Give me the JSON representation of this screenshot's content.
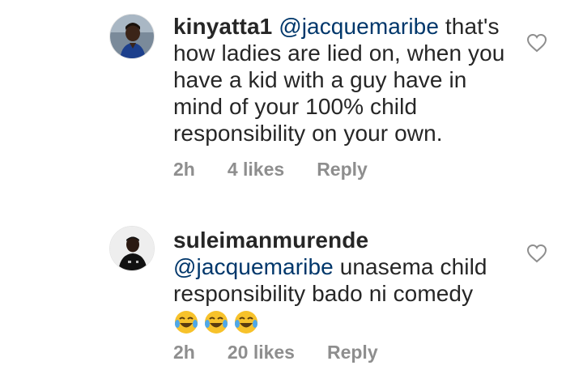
{
  "comments": [
    {
      "username": "kinyatta1",
      "mention": "@jacquemaribe",
      "text": " that's how ladies are lied on, when you have a kid with a guy have in mind of your 100% child responsibility on your own.",
      "time": "2h",
      "likes": "4 likes",
      "reply": "Reply",
      "avatar_icon": "profile-photo"
    },
    {
      "username": "suleimanmurende",
      "mention": "@jacquemaribe",
      "text": " unasema child responsibility bado ni comedy",
      "emoji": [
        "😂",
        "😂",
        "😂"
      ],
      "time": "2h",
      "likes": "20 likes",
      "reply": "Reply",
      "avatar_icon": "profile-photo"
    }
  ],
  "colors": {
    "text": "#262626",
    "mention": "#00376b",
    "meta": "#8e8e8e"
  }
}
